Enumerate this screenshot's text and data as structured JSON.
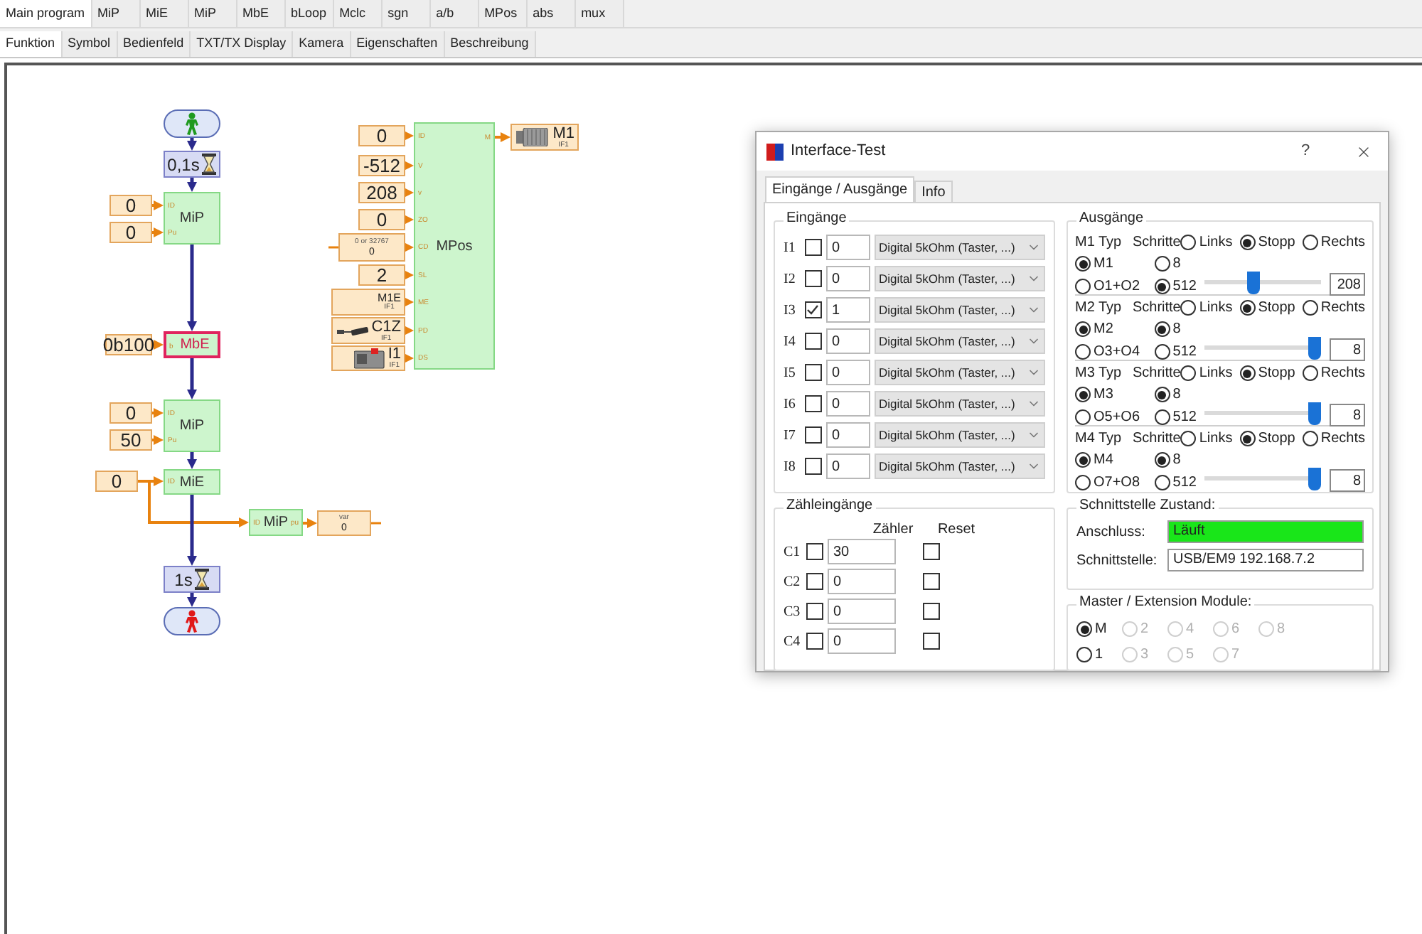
{
  "program_tabs": [
    {
      "label": "Main program",
      "selected": true
    },
    {
      "label": "MiP",
      "selected": false
    },
    {
      "label": "MiE",
      "selected": false
    },
    {
      "label": "MiP",
      "selected": false
    },
    {
      "label": "MbE",
      "selected": false
    },
    {
      "label": "bLoop",
      "selected": false
    },
    {
      "label": "Mclc",
      "selected": false
    },
    {
      "label": "sgn",
      "selected": false
    },
    {
      "label": "a/b",
      "selected": false
    },
    {
      "label": "MPos",
      "selected": false
    },
    {
      "label": "abs",
      "selected": false
    },
    {
      "label": "mux",
      "selected": false
    }
  ],
  "view_tabs": [
    {
      "label": "Funktion",
      "selected": true
    },
    {
      "label": "Symbol",
      "selected": false
    },
    {
      "label": "Bedienfeld",
      "selected": false
    },
    {
      "label": "TXT/TX Display",
      "selected": false
    },
    {
      "label": "Kamera",
      "selected": false
    },
    {
      "label": "Eigenschaften",
      "selected": false
    },
    {
      "label": "Beschreibung",
      "selected": false
    }
  ],
  "diagram": {
    "nodes": [
      {
        "kind": "start"
      },
      {
        "kind": "timer",
        "label": "0,1s"
      },
      {
        "kind": "block",
        "label": "MiP",
        "selected": false,
        "ports": [
          {
            "name": "ID",
            "kind": "const",
            "value": "0"
          },
          {
            "name": "Pu",
            "kind": "const",
            "value": "0"
          }
        ]
      },
      {
        "kind": "block",
        "label": "MbE",
        "selected": true,
        "ports": [
          {
            "name": "b",
            "kind": "const",
            "value": "0b100"
          }
        ]
      },
      {
        "kind": "block",
        "label": "MiP",
        "selected": false,
        "ports": [
          {
            "name": "ID",
            "kind": "const",
            "value": "0"
          },
          {
            "name": "Pu",
            "kind": "const",
            "value": "50"
          }
        ]
      },
      {
        "kind": "block",
        "label": "MiE",
        "selected": false,
        "ports": [
          {
            "name": "ID",
            "kind": "const",
            "value": "0"
          }
        ]
      },
      {
        "kind": "block",
        "label": "MiP",
        "selected": false,
        "ports": [
          {
            "name": "ID",
            "kind": "link"
          }
        ],
        "output": {
          "name": "pu",
          "kind": "variable",
          "caption": "var",
          "value": "0"
        }
      },
      {
        "kind": "timer",
        "label": "1s"
      },
      {
        "kind": "end"
      },
      {
        "kind": "block",
        "label": "MPos",
        "selected": false,
        "ports": [
          {
            "name": "ID",
            "kind": "const",
            "value": "0"
          },
          {
            "name": "V",
            "kind": "const",
            "value": "-512"
          },
          {
            "name": "v",
            "kind": "const",
            "value": "208"
          },
          {
            "name": "ZO",
            "kind": "const",
            "value": "0"
          },
          {
            "name": "CD",
            "kind": "variable",
            "caption": "0 or 32767",
            "value": "0"
          },
          {
            "name": "SL",
            "kind": "const",
            "value": "2"
          },
          {
            "name": "ME",
            "kind": "device",
            "value": "M1E",
            "interface": "IF1"
          },
          {
            "name": "PD",
            "kind": "device",
            "value": "C1Z",
            "interface": "IF1"
          },
          {
            "name": "DS",
            "kind": "device",
            "value": "I1",
            "interface": "IF1"
          }
        ],
        "output": {
          "name": "M",
          "kind": "device",
          "value": "M1",
          "interface": "IF1"
        }
      }
    ]
  },
  "dialog": {
    "title": "Interface-Test",
    "help": "?",
    "tabs": [
      {
        "label": "Eingänge / Ausgänge",
        "selected": true
      },
      {
        "label": "Info",
        "selected": false
      }
    ],
    "inputs": {
      "title": "Eingänge",
      "rows": [
        {
          "label": "I1",
          "checked": false,
          "value": "0",
          "mode": "Digital 5kOhm (Taster, ...)"
        },
        {
          "label": "I2",
          "checked": false,
          "value": "0",
          "mode": "Digital 5kOhm (Taster, ...)"
        },
        {
          "label": "I3",
          "checked": true,
          "value": "1",
          "mode": "Digital 5kOhm (Taster, ...)"
        },
        {
          "label": "I4",
          "checked": false,
          "value": "0",
          "mode": "Digital 5kOhm (Taster, ...)"
        },
        {
          "label": "I5",
          "checked": false,
          "value": "0",
          "mode": "Digital 5kOhm (Taster, ...)"
        },
        {
          "label": "I6",
          "checked": false,
          "value": "0",
          "mode": "Digital 5kOhm (Taster, ...)"
        },
        {
          "label": "I7",
          "checked": false,
          "value": "0",
          "mode": "Digital 5kOhm (Taster, ...)"
        },
        {
          "label": "I8",
          "checked": false,
          "value": "0",
          "mode": "Digital 5kOhm (Taster, ...)"
        }
      ]
    },
    "outputs": {
      "title": "Ausgänge",
      "motors": [
        {
          "type_label": "M1 Typ",
          "steps_label": "Schritte",
          "directions": [
            {
              "label": "Links",
              "selected": false
            },
            {
              "label": "Stopp",
              "selected": true
            },
            {
              "label": "Rechts",
              "selected": false
            }
          ],
          "types": [
            {
              "label": "M1",
              "selected": true
            },
            {
              "label": "O1+O2",
              "selected": false
            }
          ],
          "steps": [
            {
              "label": "8",
              "selected": false
            },
            {
              "label": "512",
              "selected": true
            }
          ],
          "level": 0.41,
          "value": "208"
        },
        {
          "type_label": "M2 Typ",
          "steps_label": "Schritte",
          "directions": [
            {
              "label": "Links",
              "selected": false
            },
            {
              "label": "Stopp",
              "selected": true
            },
            {
              "label": "Rechts",
              "selected": false
            }
          ],
          "types": [
            {
              "label": "M2",
              "selected": true
            },
            {
              "label": "O3+O4",
              "selected": false
            }
          ],
          "steps": [
            {
              "label": "8",
              "selected": true
            },
            {
              "label": "512",
              "selected": false
            }
          ],
          "level": 1,
          "value": "8"
        },
        {
          "type_label": "M3 Typ",
          "steps_label": "Schritte",
          "directions": [
            {
              "label": "Links",
              "selected": false
            },
            {
              "label": "Stopp",
              "selected": true
            },
            {
              "label": "Rechts",
              "selected": false
            }
          ],
          "types": [
            {
              "label": "M3",
              "selected": true
            },
            {
              "label": "O5+O6",
              "selected": false
            }
          ],
          "steps": [
            {
              "label": "8",
              "selected": true
            },
            {
              "label": "512",
              "selected": false
            }
          ],
          "level": 1,
          "value": "8"
        },
        {
          "type_label": "M4 Typ",
          "steps_label": "Schritte",
          "directions": [
            {
              "label": "Links",
              "selected": false
            },
            {
              "label": "Stopp",
              "selected": true
            },
            {
              "label": "Rechts",
              "selected": false
            }
          ],
          "types": [
            {
              "label": "M4",
              "selected": true
            },
            {
              "label": "O7+O8",
              "selected": false
            }
          ],
          "steps": [
            {
              "label": "8",
              "selected": true
            },
            {
              "label": "512",
              "selected": false
            }
          ],
          "level": 1,
          "value": "8"
        }
      ]
    },
    "counters": {
      "title": "Zähleingänge",
      "headers": [
        "Zähler",
        "Reset"
      ],
      "rows": [
        {
          "label": "C1",
          "checked": false,
          "value": "30",
          "reset": false
        },
        {
          "label": "C2",
          "checked": false,
          "value": "0",
          "reset": false
        },
        {
          "label": "C3",
          "checked": false,
          "value": "0",
          "reset": false
        },
        {
          "label": "C4",
          "checked": false,
          "value": "0",
          "reset": false
        }
      ]
    },
    "status": {
      "title": "Schnittstelle Zustand:",
      "fields": [
        {
          "label": "Anschluss:",
          "value": "Läuft",
          "ok": true
        },
        {
          "label": "Schnittstelle:",
          "value": "USB/EM9 192.168.7.2",
          "ok": false
        }
      ]
    },
    "modules": {
      "title": "Master / Extension Module:",
      "options": [
        {
          "label": "M",
          "selected": true,
          "disabled": false
        },
        {
          "label": "2",
          "selected": false,
          "disabled": true
        },
        {
          "label": "4",
          "selected": false,
          "disabled": true
        },
        {
          "label": "6",
          "selected": false,
          "disabled": true
        },
        {
          "label": "8",
          "selected": false,
          "disabled": true
        },
        {
          "label": "1",
          "selected": false,
          "disabled": false
        },
        {
          "label": "3",
          "selected": false,
          "disabled": true
        },
        {
          "label": "5",
          "selected": false,
          "disabled": true
        },
        {
          "label": "7",
          "selected": false,
          "disabled": true
        }
      ]
    }
  }
}
